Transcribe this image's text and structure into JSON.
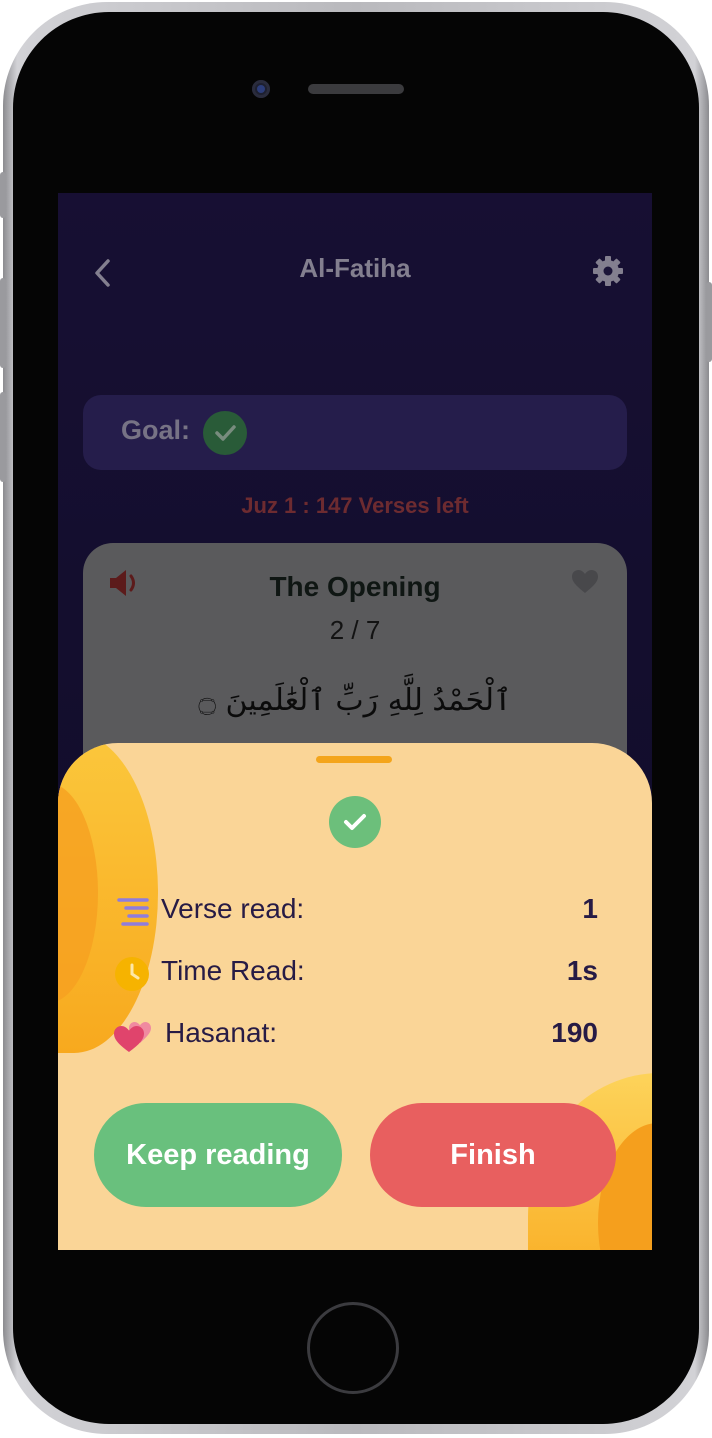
{
  "header": {
    "title": "Al-Fatiha",
    "back_icon": "chevron-left-icon",
    "settings_icon": "gear-icon"
  },
  "goal": {
    "label": "Goal:",
    "status_icon": "check-circle-icon",
    "complete": true
  },
  "juz_status": "Juz 1 : 147 Verses left",
  "verse_card": {
    "title": "The Opening",
    "progress": "2 / 7",
    "arabic": "ٱلْحَمْدُ لِلَّهِ رَبِّ ٱلْعَٰلَمِينَ ۝",
    "audio_icon": "speaker-icon",
    "favorite_icon": "heart-icon"
  },
  "summary_sheet": {
    "status_icon": "check-circle-icon",
    "stats": [
      {
        "icon": "list-lines-icon",
        "label": "Verse read:",
        "value": "1"
      },
      {
        "icon": "clock-icon",
        "label": "Time Read:",
        "value": "1s"
      },
      {
        "icon": "hearts-icon",
        "label": "Hasanat:",
        "value": "190"
      }
    ],
    "keep_label": "Keep reading",
    "finish_label": "Finish"
  },
  "colors": {
    "background": "#1d1544",
    "goal_bar": "#3a2d74",
    "sheet": "#fad597",
    "keep_button": "#69c07d",
    "finish_button": "#e85f5f",
    "text_dark": "#271b45"
  }
}
